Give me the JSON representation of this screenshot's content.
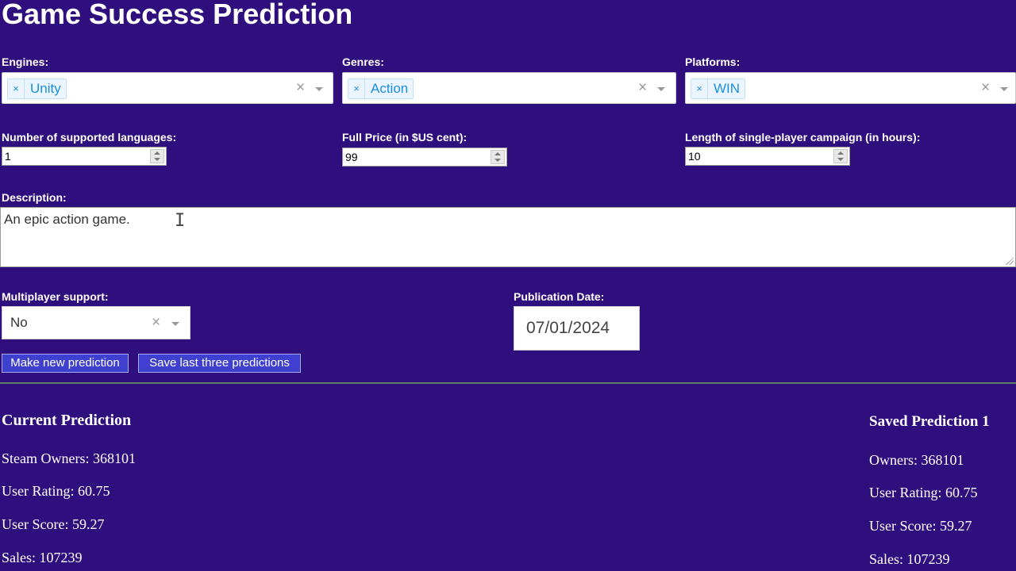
{
  "page": {
    "title": "Game Success Prediction"
  },
  "engines": {
    "label": "Engines:",
    "selected": "Unity"
  },
  "genres": {
    "label": "Genres:",
    "selected": "Action"
  },
  "platforms": {
    "label": "Platforms:",
    "selected": "WIN"
  },
  "remove_glyph": "×",
  "clear_glyph": "×",
  "languages": {
    "label": "Number of supported languages:",
    "value": "1"
  },
  "price": {
    "label": "Full Price (in $US cent):",
    "value": "99"
  },
  "campaign": {
    "label": "Length of single-player campaign (in hours):",
    "value": "10"
  },
  "description": {
    "label": "Description:",
    "value": "An epic action game."
  },
  "multiplayer": {
    "label": "Multiplayer support:",
    "value": "No"
  },
  "publication": {
    "label": "Publication Date:",
    "value": "07/01/2024"
  },
  "buttons": {
    "make": "Make new prediction",
    "save": "Save last three predictions"
  },
  "current": {
    "heading": "Current Prediction",
    "owners": "Steam Owners: 368101",
    "rating": "User Rating: 60.75",
    "score": "User Score: 59.27",
    "sales": "Sales: 107239"
  },
  "saved1": {
    "heading": "Saved Prediction 1",
    "owners": "Owners: 368101",
    "rating": "User Rating: 60.75",
    "score": "User Score: 59.27",
    "sales": "Sales: 107239"
  }
}
